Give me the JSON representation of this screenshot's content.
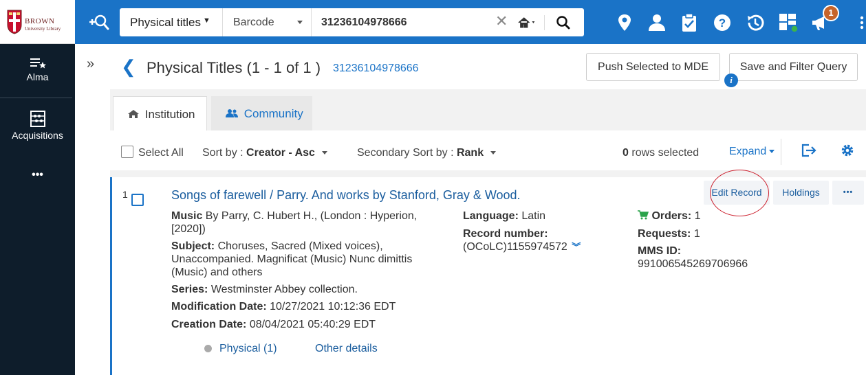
{
  "logo": {
    "name": "BROWN",
    "sub": "University Library"
  },
  "search": {
    "scope": "Physical titles",
    "field": "Barcode",
    "value": "31236104978666"
  },
  "notifications": {
    "count": "1"
  },
  "leftnav": {
    "items": [
      {
        "label": "Alma",
        "icon": "menu-star-icon"
      },
      {
        "label": "Acquisitions",
        "icon": "abacus-icon"
      }
    ],
    "more": "•••"
  },
  "header": {
    "title": "Physical Titles (1 - 1 of 1 )",
    "query": "31236104978666",
    "push_button": "Push Selected to MDE",
    "save_button": "Save and Filter Query",
    "info_icon": "i"
  },
  "tabs": [
    {
      "label": "Institution",
      "icon": "home-icon"
    },
    {
      "label": "Community",
      "icon": "people-icon"
    }
  ],
  "toolbar": {
    "select_all": "Select All",
    "sort_label": "Sort by :",
    "sort_value": "Creator - Asc",
    "secondary_sort_label": "Secondary Sort by :",
    "secondary_sort_value": "Rank",
    "rows_selected_count": "0",
    "rows_selected_text": "rows selected",
    "expand": "Expand"
  },
  "result": {
    "index": "1",
    "title": "Songs of farewell / Parry. And works by Stanford, Gray & Wood.",
    "type_label": "Music",
    "type_value": "By Parry, C. Hubert H., (London : Hyperion,",
    "type_value_2": "[2020])",
    "subject_label": "Subject:",
    "subject_value": "Choruses, Sacred (Mixed voices),",
    "subject_value_2": "Unaccompanied. Magnificat (Music) Nunc dimittis",
    "subject_value_3": "(Music) and others",
    "series_label": "Series:",
    "series_value": "Westminster Abbey collection.",
    "modification_label": "Modification Date:",
    "modification_value": "10/27/2021 10:12:36 EDT",
    "creation_label": "Creation Date:",
    "creation_value": "08/04/2021 05:40:29 EDT",
    "language_label": "Language:",
    "language_value": "Latin",
    "record_number_label": "Record number:",
    "record_number_value": "(OCoLC)1155974572",
    "orders_label": "Orders:",
    "orders_value": "1",
    "requests_label": "Requests:",
    "requests_value": "1",
    "mms_label": "MMS ID:",
    "mms_value": "991006545269706966",
    "physical_link": "Physical (1)",
    "other_details_link": "Other details",
    "edit_record": "Edit Record",
    "holdings": "Holdings",
    "more": "•••"
  },
  "colors": {
    "topbar": "#1a73c7",
    "leftnav": "#0e1d2b",
    "link": "#1a5d9e",
    "annotation": "#cc1f2d",
    "badge": "#c6642a"
  }
}
